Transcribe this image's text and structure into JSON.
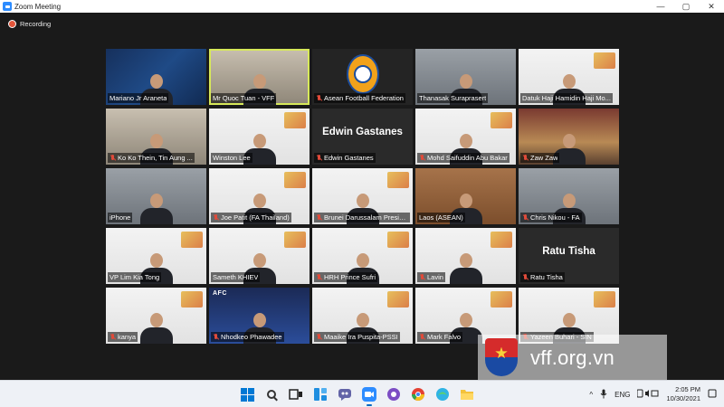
{
  "window": {
    "title": "Zoom Meeting",
    "controls": [
      "—",
      "▢",
      "✕"
    ]
  },
  "meeting": {
    "recording_label": "Recording"
  },
  "participants": [
    {
      "name": "Mariano Jr Araneta",
      "muted": false,
      "bg": "blue"
    },
    {
      "name": "Mr Quoc Tuan - VFF",
      "muted": false,
      "bg": "room",
      "active": true
    },
    {
      "name": "Asean Football Federation",
      "muted": true,
      "bg": "dark",
      "logo": true
    },
    {
      "name": "Thanasak Suraprasert",
      "muted": false,
      "bg": "gray"
    },
    {
      "name": "Datuk Haji Hamidin Haji Mo...",
      "muted": false,
      "bg": "white"
    },
    {
      "name": "Ko Ko Thein, Tin Aung ...",
      "muted": true,
      "bg": "room"
    },
    {
      "name": "Winston Lee",
      "muted": false,
      "bg": "white"
    },
    {
      "name": "Edwin Gastanes",
      "muted": true,
      "bg": "black",
      "big_name": "Edwin Gastanes"
    },
    {
      "name": "Mohd Saifuddin Abu Bakar",
      "muted": true,
      "bg": "white"
    },
    {
      "name": "Zaw Zaw",
      "muted": true,
      "bg": "red"
    },
    {
      "name": "iPhone",
      "muted": false,
      "bg": "gray"
    },
    {
      "name": "Joe Patit (FA Thailand)",
      "muted": true,
      "bg": "white"
    },
    {
      "name": "Brunei Darussalam Presid...",
      "muted": true,
      "bg": "white"
    },
    {
      "name": "Laos (ASEAN)",
      "muted": false,
      "bg": "wood"
    },
    {
      "name": "Chris Nikou - FA",
      "muted": true,
      "bg": "gray"
    },
    {
      "name": "VP Lim Kia Tong",
      "muted": false,
      "bg": "white"
    },
    {
      "name": "Sameth KHIEV",
      "muted": false,
      "bg": "white"
    },
    {
      "name": "HRH Prince Sufri",
      "muted": true,
      "bg": "white"
    },
    {
      "name": "Lavin",
      "muted": true,
      "bg": "white"
    },
    {
      "name": "Ratu Tisha",
      "muted": true,
      "bg": "black",
      "big_name": "Ratu Tisha"
    },
    {
      "name": "kanya",
      "muted": true,
      "bg": "white"
    },
    {
      "name": "Nhodkeo Phawadee",
      "muted": true,
      "bg": "navy",
      "afc": "AFC"
    },
    {
      "name": "Maaike Ira Puspita-PSSI",
      "muted": true,
      "bg": "white"
    },
    {
      "name": "Mark Falvo",
      "muted": true,
      "bg": "white"
    },
    {
      "name": "Yazeen Buhari - SIN",
      "muted": true,
      "bg": "white"
    }
  ],
  "watermark": {
    "text": "vff.org.vn"
  },
  "taskbar": {
    "apps": [
      "start-icon",
      "search-icon",
      "task-view-icon",
      "widgets-icon",
      "teams-chat-icon",
      "zoom-icon",
      "camera-icon",
      "chrome-icon",
      "browser-icon",
      "file-explorer-icon"
    ],
    "language": "ENG",
    "time": "2:05 PM",
    "date": "10/30/2021",
    "tray_chevron": "^"
  }
}
